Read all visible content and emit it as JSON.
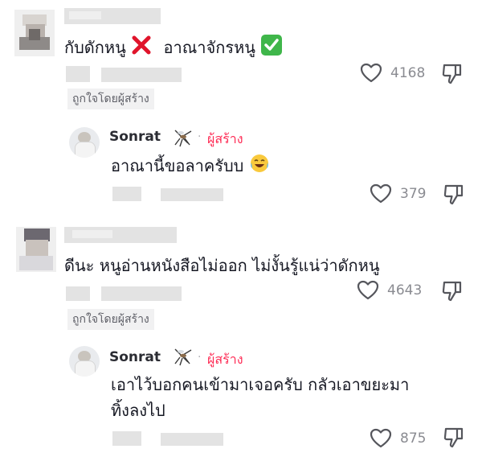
{
  "comments": [
    {
      "text": "กับดักหนู",
      "text_after": "อาณาจักรหนู",
      "likes": "4168",
      "liked_by_creator": "ถูกใจโดยผู้สร้าง",
      "reply": {
        "author": "Sonrat",
        "creator_label": "ผู้สร้าง",
        "text": "อาณานี้ขอลาครับบ",
        "likes": "379"
      }
    },
    {
      "text": "ดีนะ หนูอ่านหนังสือไม่ออก ไม่งั้นรู้แน่ว่าดักหนู",
      "likes": "4643",
      "liked_by_creator": "ถูกใจโดยผู้สร้าง",
      "reply": {
        "author": "Sonrat",
        "creator_label": "ผู้สร้าง",
        "text_line1": "เอาไว้บอกคนเข้ามาเจอครับ กลัวเอาขยะมา",
        "text_line2": "ทิ้งลงไป",
        "likes": "875"
      }
    }
  ],
  "icons": {
    "cross": "cross-mark-icon",
    "check": "check-mark-icon",
    "laugh": "tears-of-joy-icon",
    "heart": "heart-icon",
    "dislike": "thumbs-down-icon",
    "mosquito": "mosquito-icon"
  },
  "colors": {
    "creator": "#fe2c55",
    "muted": "#8a8b91"
  }
}
